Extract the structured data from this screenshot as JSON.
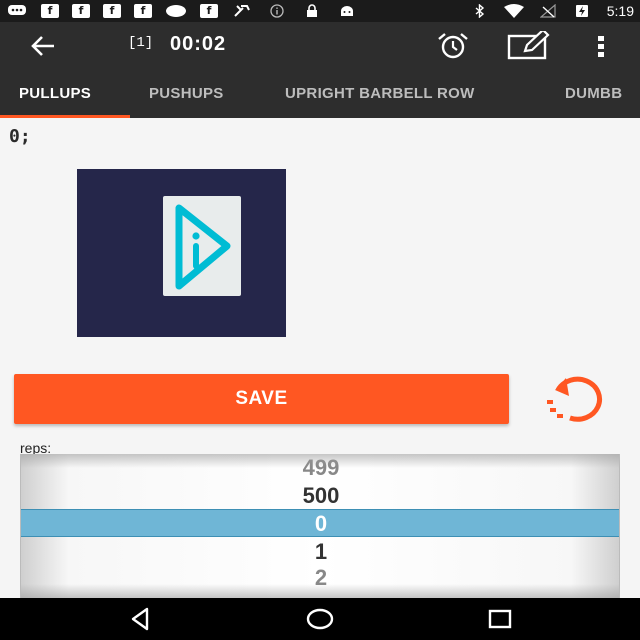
{
  "status_bar": {
    "time": "5:19",
    "left_icons": [
      "chat-bubble-icon",
      "facebook-icon",
      "facebook-icon",
      "facebook-icon",
      "facebook-icon",
      "cloud-icon",
      "facebook-icon",
      "tool-icon",
      "info-icon",
      "lock-icon",
      "android-icon"
    ],
    "right_icons": [
      "bluetooth-icon",
      "wifi-icon",
      "no-signal-icon",
      "battery-charging-icon"
    ],
    "fb_letter": "f"
  },
  "toolbar": {
    "counter": "[1]",
    "timer": "00:02",
    "back_icon": "arrow-back-icon",
    "alarm_icon": "alarm-icon",
    "edit_icon": "edit-icon",
    "more_icon": "more-vert-icon"
  },
  "tabs": {
    "items": [
      {
        "label": "PULLUPS"
      },
      {
        "label": "PUSHUPS"
      },
      {
        "label": "UPRIGHT BARBELL ROW"
      },
      {
        "label": "DUMBB"
      }
    ],
    "active_index": 0,
    "indicator_color": "#ff5722"
  },
  "main": {
    "value_text": "0;",
    "image_icon": "play-info-logo-icon",
    "save_label": "SAVE",
    "reset_icon": "reset-icon",
    "reps_label": "reps:",
    "picker_values": [
      "499",
      "500",
      "0",
      "1",
      "2"
    ],
    "picker_selected": "0"
  },
  "colors": {
    "accent": "#ff5722",
    "toolbar": "#2d2d2d",
    "statusbar": "#1b1b1b",
    "picker_selected": "#6fb6d6",
    "image_background": "#25264a",
    "logo": "#00bcd4"
  },
  "nav_bar": {
    "back_icon": "nav-back-icon",
    "home_icon": "nav-home-icon",
    "recents_icon": "nav-recents-icon"
  }
}
